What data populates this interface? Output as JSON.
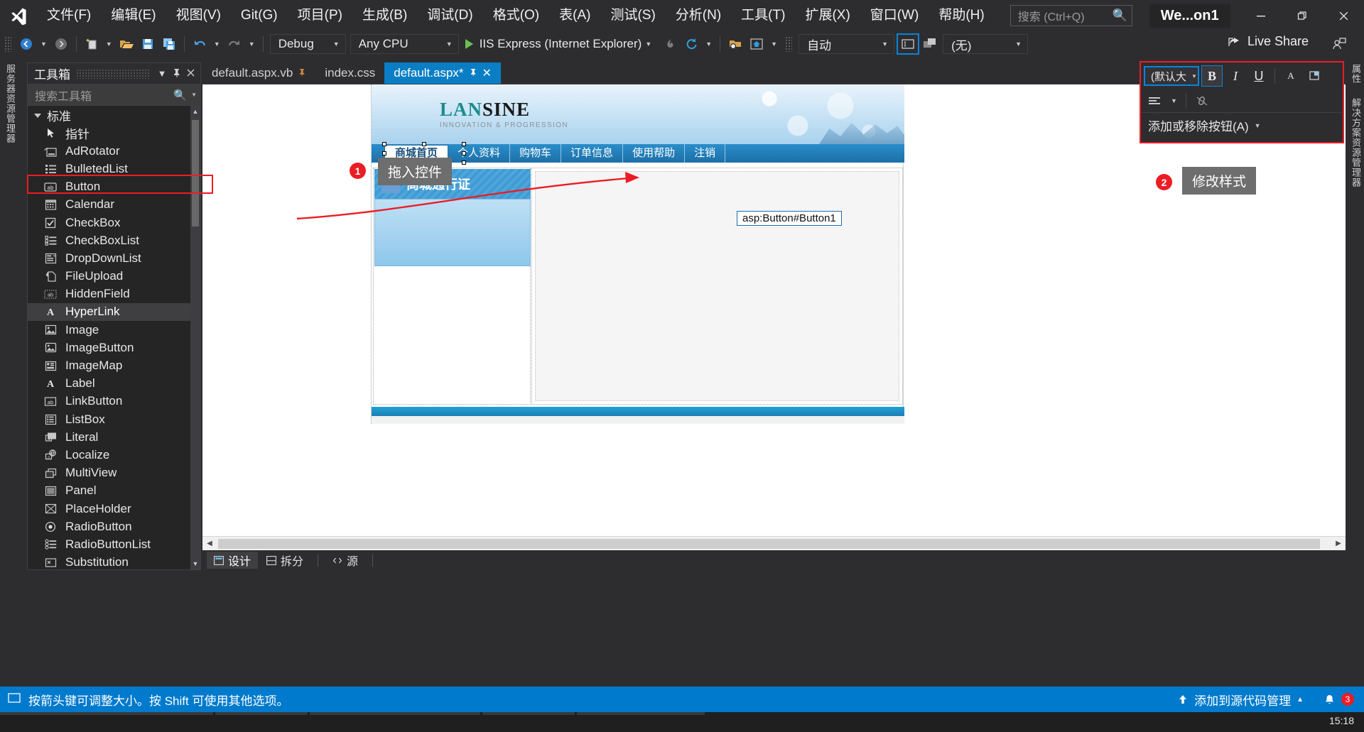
{
  "titlebar": {
    "logo_icon": "visual-studio-logo",
    "menus": [
      "文件(F)",
      "编辑(E)",
      "视图(V)",
      "Git(G)",
      "项目(P)",
      "生成(B)",
      "调试(D)",
      "格式(O)",
      "表(A)",
      "测试(S)",
      "分析(N)",
      "工具(T)",
      "扩展(X)",
      "窗口(W)",
      "帮助(H)"
    ],
    "search_placeholder": "搜索 (Ctrl+Q)",
    "search_icon": "search-icon",
    "window_name": "We...on1",
    "minimize_icon": "minimize-icon",
    "restore_icon": "restore-icon",
    "close_icon": "close-icon"
  },
  "toolbar": {
    "back_icon": "navigate-back-icon",
    "forward_icon": "navigate-forward-icon",
    "new_item_icon": "new-item-icon",
    "open_icon": "open-file-icon",
    "save_icon": "save-icon",
    "save_all_icon": "save-all-icon",
    "undo_icon": "undo-icon",
    "redo_icon": "redo-icon",
    "config_value": "Debug",
    "platform_value": "Any CPU",
    "run_target": "IIS Express (Internet Explorer)",
    "run_icon": "play-icon",
    "hot_reload_icon": "hot-reload-icon",
    "refresh_icon": "refresh-icon",
    "find_in_files_icon": "find-in-files-icon",
    "home_icon": "home-icon",
    "target_schema_value": "自动",
    "style_app_icon": "style-application-icon",
    "split_icon": "split-view-icon",
    "target_rule_value": "(无)",
    "live_share_label": "Live Share",
    "live_share_icon": "live-share-icon",
    "feedback_icon": "send-feedback-icon"
  },
  "left_dock_tabs": [
    "服务器资源管理器"
  ],
  "right_dock_tabs": [
    "属性",
    "解决方案资源管理器"
  ],
  "toolbox": {
    "title": "工具箱",
    "pin_icon": "pin-icon",
    "close_icon": "close-icon",
    "dropdown_icon": "chevron-down-icon",
    "search_placeholder": "搜索工具箱",
    "search_icon": "search-icon",
    "group_label": "标准",
    "items": [
      {
        "label": "指针",
        "icon": "pointer-icon"
      },
      {
        "label": "AdRotator",
        "icon": "adrotator-icon"
      },
      {
        "label": "BulletedList",
        "icon": "bulletedlist-icon"
      },
      {
        "label": "Button",
        "icon": "button-icon"
      },
      {
        "label": "Calendar",
        "icon": "calendar-icon"
      },
      {
        "label": "CheckBox",
        "icon": "checkbox-icon"
      },
      {
        "label": "CheckBoxList",
        "icon": "checkboxlist-icon"
      },
      {
        "label": "DropDownList",
        "icon": "dropdownlist-icon"
      },
      {
        "label": "FileUpload",
        "icon": "fileupload-icon"
      },
      {
        "label": "HiddenField",
        "icon": "hiddenfield-icon"
      },
      {
        "label": "HyperLink",
        "icon": "hyperlink-icon"
      },
      {
        "label": "Image",
        "icon": "image-icon"
      },
      {
        "label": "ImageButton",
        "icon": "imagebutton-icon"
      },
      {
        "label": "ImageMap",
        "icon": "imagemap-icon"
      },
      {
        "label": "Label",
        "icon": "label-icon"
      },
      {
        "label": "LinkButton",
        "icon": "linkbutton-icon"
      },
      {
        "label": "ListBox",
        "icon": "listbox-icon"
      },
      {
        "label": "Literal",
        "icon": "literal-icon"
      },
      {
        "label": "Localize",
        "icon": "localize-icon"
      },
      {
        "label": "MultiView",
        "icon": "multiview-icon"
      },
      {
        "label": "Panel",
        "icon": "panel-icon"
      },
      {
        "label": "PlaceHolder",
        "icon": "placeholder-icon"
      },
      {
        "label": "RadioButton",
        "icon": "radiobutton-icon"
      },
      {
        "label": "RadioButtonList",
        "icon": "radiobuttonlist-icon"
      },
      {
        "label": "Substitution",
        "icon": "substitution-icon"
      }
    ],
    "selected_item": "HyperLink",
    "highlighted_item": "Button"
  },
  "document_tabs": [
    {
      "label": "default.aspx.vb",
      "active": false,
      "pinned": true
    },
    {
      "label": "index.css",
      "active": false,
      "pinned": false
    },
    {
      "label": "default.aspx*",
      "active": true,
      "pinned": true
    }
  ],
  "designer": {
    "asp_tag": "asp:Button#Button1",
    "site": {
      "logo_primary": "LAN",
      "logo_secondary": "SINE",
      "logo_tagline": "INNOVATION & PROGRESSION",
      "nav": [
        "商城首页",
        "个人资料",
        "购物车",
        "订单信息",
        "使用帮助",
        "注销"
      ],
      "panel_title": "商城通行证",
      "panel_avatar_icon": "user-avatar-icon"
    },
    "view_tabs": [
      {
        "label": "设计",
        "icon": "design-view-icon",
        "active": true
      },
      {
        "label": "拆分",
        "icon": "split-view-icon",
        "active": false
      },
      {
        "label": "源",
        "icon": "source-view-icon",
        "active": false
      }
    ]
  },
  "format_toolbar": {
    "font_size_value": "(默认大",
    "bold_label": "B",
    "italic_label": "I",
    "underline_label": "U",
    "foreground_icon": "foreground-color-icon",
    "background_icon": "background-color-icon",
    "align_icon": "align-left-icon",
    "break_link_icon": "break-link-icon",
    "add_remove_label": "添加或移除按钮(A)",
    "add_remove_caret": "chevron-down-icon"
  },
  "annotations": [
    {
      "number": "1",
      "label": "拖入控件"
    },
    {
      "number": "2",
      "label": "修改样式"
    }
  ],
  "statusbar": {
    "hint_icon": "resize-hint-icon",
    "hint_text": "按箭头键可调整大小。按 Shift 可使用其他选项。",
    "source_control_icon": "publish-icon",
    "source_control_label": "添加到源代码管理",
    "source_control_caret": "chevron-up-icon",
    "notifications_icon": "bell-icon",
    "notifications_count": "3"
  },
  "taskbar": {
    "clock": "15:18"
  },
  "colors": {
    "accent_blue": "#007acc",
    "chrome_dark": "#2d2d30",
    "panel_dark": "#252526",
    "highlight_red": "#ec1c24",
    "tab_active": "#0a7ec4",
    "anno_gray": "#6e6e6e"
  }
}
